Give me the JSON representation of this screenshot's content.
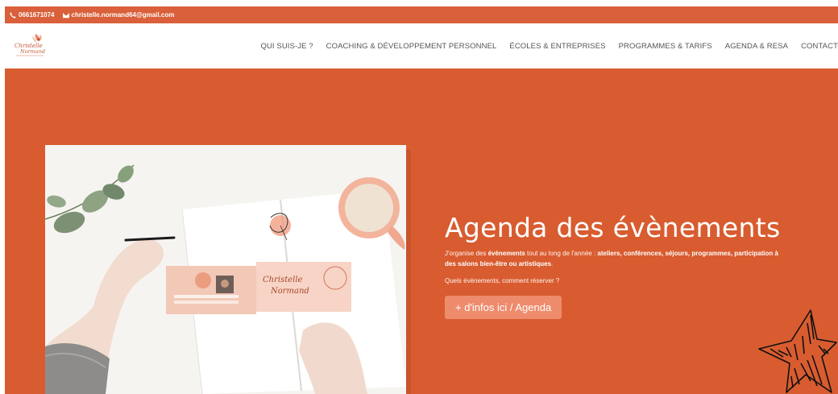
{
  "topbar": {
    "phone": "0661671074",
    "email": "christelle.normand64@gmail.com"
  },
  "logo": {
    "text_line1": "Christelle",
    "text_line2": "Normand"
  },
  "nav": {
    "items": [
      "QUI SUIS-JE ?",
      "COACHING & DÉVELOPPEMENT PERSONNEL",
      "ÉCOLES & ENTREPRISES",
      "PROGRAMMES & TARIFS",
      "AGENDA & RESA",
      "CONTACT"
    ]
  },
  "hero": {
    "title": "Agenda des évènements",
    "desc_part1": "J'organise des ",
    "desc_bold1": "évènements",
    "desc_part2": " tout au long de l'année : ",
    "desc_bold2": "ateliers, conférences, séjours, programmes, participation à des salons bien-être ou artistiques",
    "desc_part3": ".",
    "question": "Quels évènements, comment réserver ?",
    "button": "+ d'infos ici / Agenda",
    "photo_card_text1": "Christelle",
    "photo_card_text2": "Normand"
  },
  "colors": {
    "accent": "#d85c30",
    "topbar": "#d9603a",
    "button": "#ee8b6c"
  }
}
